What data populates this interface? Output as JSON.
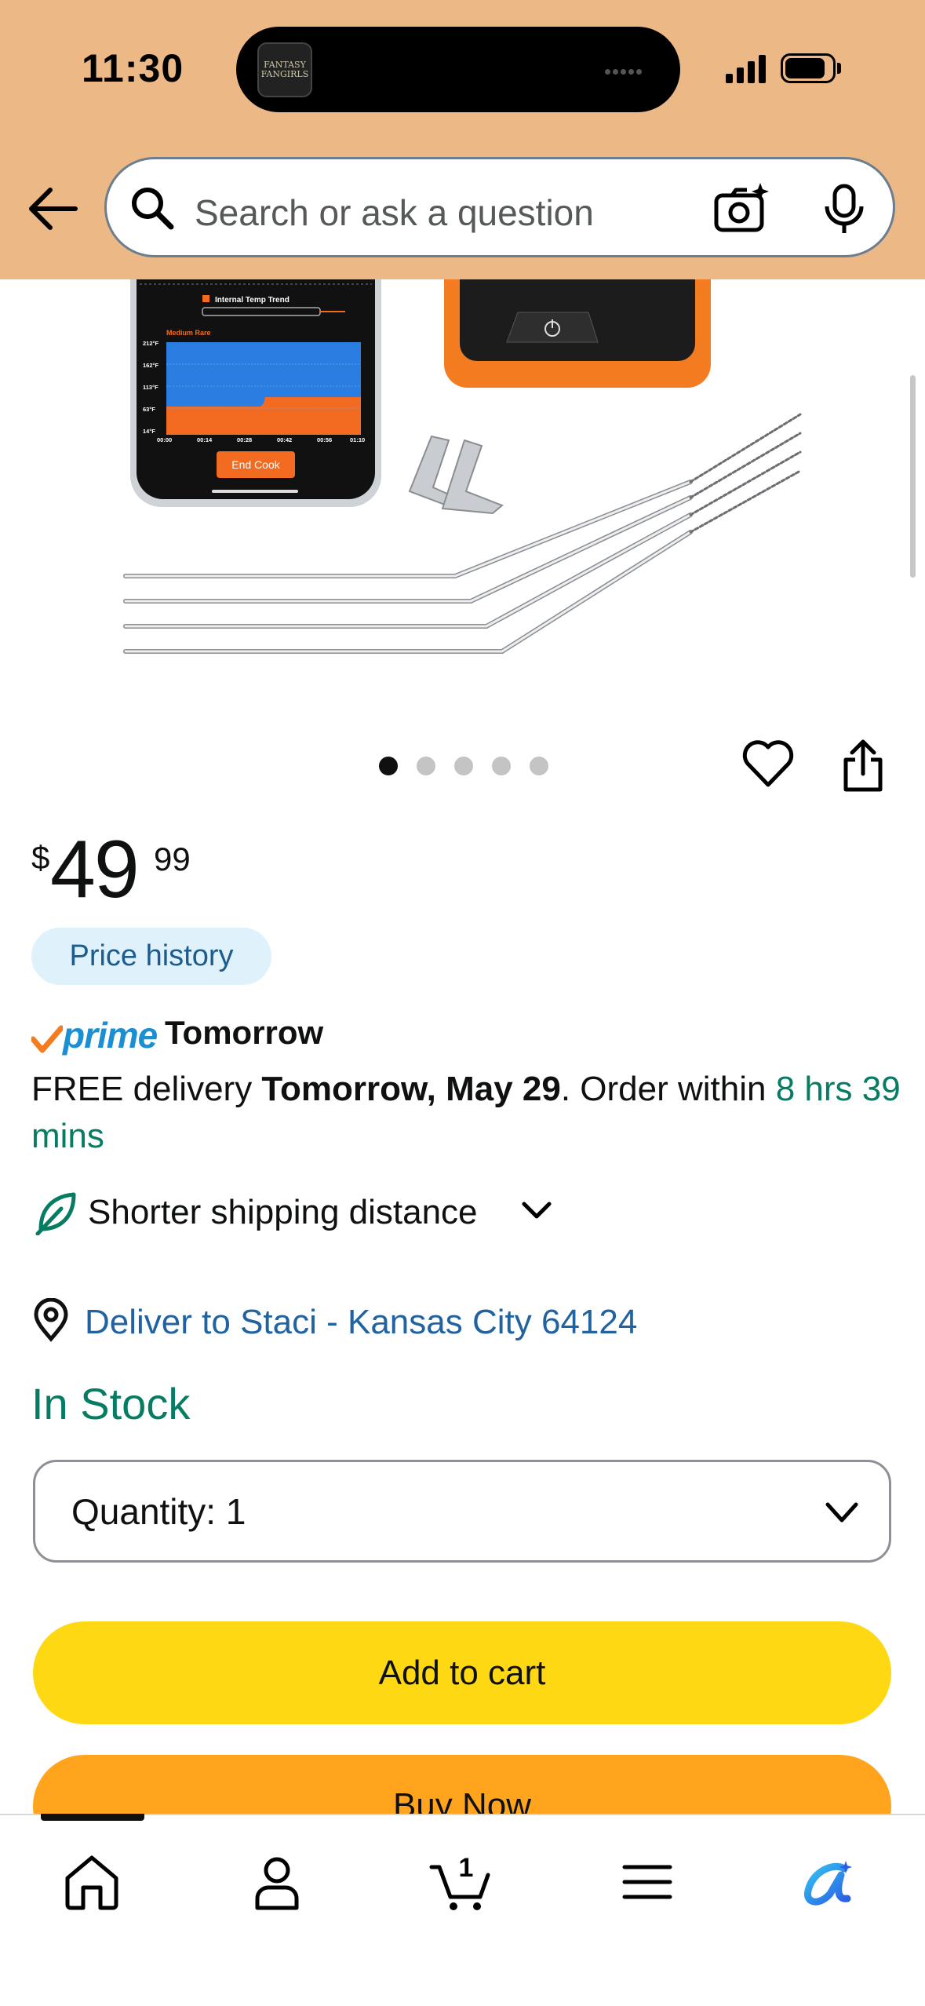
{
  "status_bar": {
    "time": "11:30",
    "island_app_label": "FANTASY FANGIRLS"
  },
  "search": {
    "placeholder": "Search or ask a question"
  },
  "product_image": {
    "screen_title": "Internal Temp Trend",
    "screen_subtitle": "Medium Rare",
    "y_ticks": [
      "212°F",
      "162°F",
      "113°F",
      "63°F",
      "14°F"
    ],
    "x_ticks": [
      "00:00",
      "00:14",
      "00:28",
      "00:42",
      "00:56",
      "01:10"
    ],
    "end_button": "End Cook",
    "active_dot": 0,
    "dot_count": 5
  },
  "price": {
    "symbol": "$",
    "whole": "49",
    "fraction": "99",
    "history_label": "Price history"
  },
  "delivery": {
    "prime_label": "prime",
    "prime_day": "Tomorrow",
    "text_prefix": "FREE delivery ",
    "date_bold": "Tomorrow, May 29",
    "text_middle": ". Order within ",
    "countdown": "8 hrs 39 mins",
    "shipping_note": "Shorter shipping distance"
  },
  "location": {
    "deliver_to": "Deliver to Staci - Kansas City 64124"
  },
  "availability": "In Stock",
  "quantity": {
    "label": "Quantity:",
    "value": "1"
  },
  "buttons": {
    "add_to_cart": "Add to cart",
    "buy_now": "Buy Now"
  },
  "nav": {
    "cart_count": "1",
    "items": [
      "home-icon",
      "account-icon",
      "cart-icon",
      "menu-icon",
      "rufus-icon"
    ]
  },
  "colors": {
    "header_bg": "#ebb886",
    "add_to_cart": "#ffd814",
    "buy_now": "#ffa41c",
    "link_blue": "#2162a1",
    "green": "#067d62"
  }
}
